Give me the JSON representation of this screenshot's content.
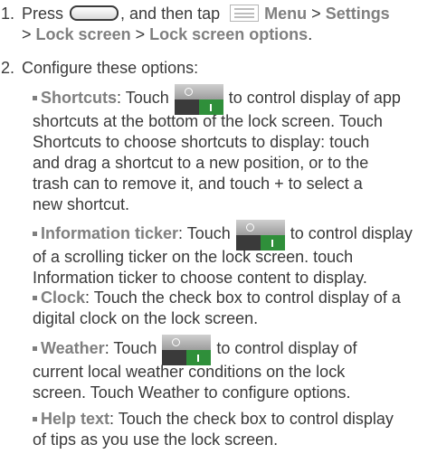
{
  "step1": {
    "num": "1.",
    "press": "Press",
    "then_tap": ", and then tap",
    "menu": "Menu",
    "gt": ">",
    "settings": "Settings",
    "lock_screen": "Lock screen",
    "lock_screen_options": "Lock screen options",
    "period": "."
  },
  "step2": {
    "num": "2.",
    "text": "Configure these options:"
  },
  "bullets": {
    "shortcuts": {
      "label": "Shortcuts",
      "touch": ": Touch",
      "line1_rest": "to control display of app",
      "line2": "shortcuts at the bottom of the lock screen. Touch",
      "line3": "Shortcuts to choose shortcuts to display: touch",
      "line4": "and drag a shortcut to a new position, or to the",
      "line5": "trash can to remove it, and touch + to select a",
      "line6": "new shortcut."
    },
    "ticker": {
      "label": "Information ticker",
      "touch": ": Touch",
      "line1_rest": "to control display",
      "line2": "of a scrolling ticker on the lock screen. touch",
      "line3": "Information ticker to choose content to display."
    },
    "clock": {
      "label": "Clock",
      "line1_rest": ": Touch the check box to control display of a",
      "line2": "digital clock on the lock screen."
    },
    "weather": {
      "label": "Weather",
      "touch": ": Touch",
      "line1_rest": "to control display of",
      "line2": "current local weather conditions on the lock",
      "line3": "screen. Touch Weather to configure options."
    },
    "help": {
      "label": "Help text",
      "line1_rest": ": Touch the check box to control display",
      "line2": "of tips as you use the lock screen."
    }
  },
  "icons": {
    "home": "home-key-icon",
    "menu": "menu-icon",
    "toggle": "on-off-switch-icon"
  },
  "colors": {
    "text": "#3a3a3a",
    "bold_label": "#7f7f7f",
    "switch_on": "#2f8f3a"
  }
}
